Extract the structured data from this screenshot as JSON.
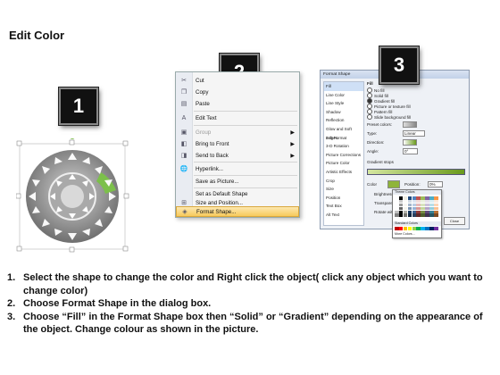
{
  "title": "Edit Color",
  "badges": [
    "1",
    "2",
    "3"
  ],
  "context_menu": {
    "items": [
      {
        "label": "Cut",
        "icon": "scissors-icon",
        "glyph": "✂",
        "disabled": false
      },
      {
        "label": "Copy",
        "icon": "copy-icon",
        "glyph": "❐",
        "disabled": false
      },
      {
        "label": "Paste",
        "icon": "paste-icon",
        "glyph": "▤",
        "disabled": false
      },
      {
        "label": "Edit Text",
        "icon": "edit-text-icon",
        "glyph": "A",
        "disabled": false
      },
      {
        "label": "Group",
        "icon": "group-icon",
        "glyph": "▣",
        "disabled": true,
        "submenu": true
      },
      {
        "label": "Bring to Front",
        "icon": "bring-front-icon",
        "glyph": "◧",
        "disabled": false,
        "submenu": true
      },
      {
        "label": "Send to Back",
        "icon": "send-back-icon",
        "glyph": "◨",
        "disabled": false,
        "submenu": true
      },
      {
        "label": "Hyperlink...",
        "icon": "hyperlink-icon",
        "glyph": "🌐",
        "disabled": false
      },
      {
        "label": "Save as Picture...",
        "icon": "",
        "glyph": "",
        "disabled": false
      },
      {
        "label": "Set as Default Shape",
        "icon": "",
        "glyph": "",
        "disabled": false
      },
      {
        "label": "Size and Position...",
        "icon": "size-position-icon",
        "glyph": "⊞",
        "disabled": false
      },
      {
        "label": "Format Shape...",
        "icon": "format-shape-icon",
        "glyph": "◈",
        "disabled": false,
        "selected": true
      }
    ]
  },
  "format_dialog": {
    "title": "Format Shape",
    "sidebar": [
      "Fill",
      "Line Color",
      "Line Style",
      "Shadow",
      "Reflection",
      "Glow and Soft Edges",
      "3-D Format",
      "3-D Rotation",
      "Picture Corrections",
      "Picture Color",
      "Artistic Effects",
      "Crop",
      "Size",
      "Position",
      "Text Box",
      "Alt Text"
    ],
    "fill_heading": "Fill",
    "fill_options": [
      "No fill",
      "Solid fill",
      "Gradient fill",
      "Picture or texture fill",
      "Pattern fill",
      "Slide background fill"
    ],
    "selected_fill": "Gradient fill",
    "labels": {
      "preset": "Preset colors:",
      "type": "Type:",
      "type_value": "Linear",
      "direction": "Direction:",
      "angle": "Angle:",
      "angle_value": "0°",
      "gradient_stops": "Gradient stops",
      "color": "Color",
      "position": "Position:",
      "position_value": "0%",
      "brightness": "Brightness:",
      "transparency": "Transparency:",
      "rotate": "Rotate with shape"
    },
    "palette": {
      "theme_header": "Theme Colors",
      "standard_header": "Standard Colors",
      "more": "More Colors...",
      "theme_top": [
        "#ffffff",
        "#000000",
        "#eeece1",
        "#1f497d",
        "#4f81bd",
        "#c0504d",
        "#9bbb59",
        "#8064a2",
        "#4bacc6",
        "#f79646"
      ],
      "standard": [
        "#c00000",
        "#ff0000",
        "#ffc000",
        "#ffff00",
        "#92d050",
        "#00b050",
        "#00b0f0",
        "#0070c0",
        "#002060",
        "#7030a0"
      ]
    },
    "close_label": "Close"
  },
  "instructions": [
    {
      "num": "1.",
      "text": "Select the shape to change the color and Right click the object( click any object which you want to change color)"
    },
    {
      "num": "2.",
      "text": "Choose Format Shape in the dialog box."
    },
    {
      "num": "3.",
      "text": "Choose “Fill” in the Format Shape box then “Solid” or “Gradient” depending on the appearance of the object. Change colour as shown in the picture."
    }
  ],
  "colors": {
    "accent_green": "#7cc04a",
    "ring_gray": "#8a8a8a",
    "menu_highlight": "#f7c95b"
  }
}
